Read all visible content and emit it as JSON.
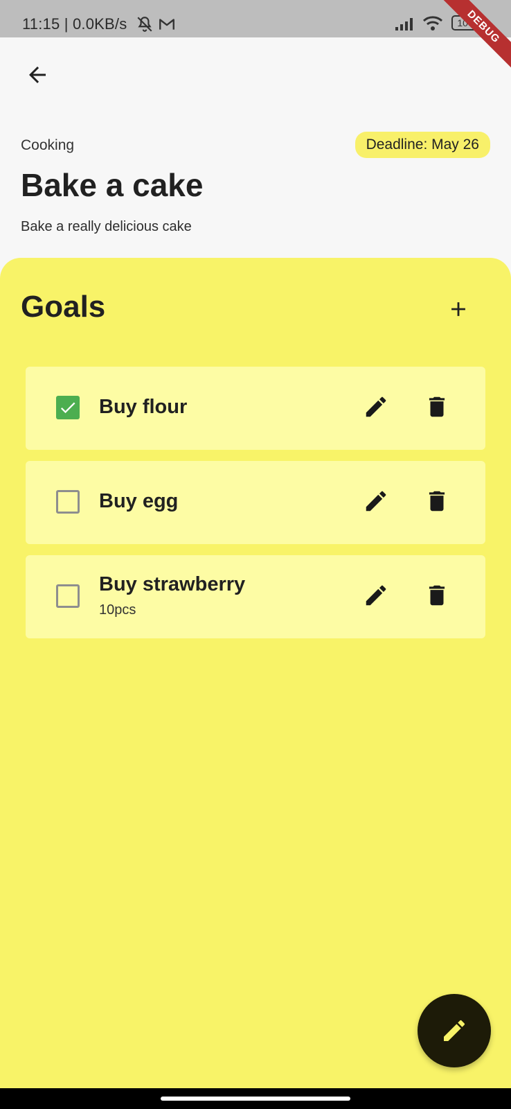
{
  "status_bar": {
    "time": "11:15",
    "network_speed": "0.0KB/s",
    "battery": "100",
    "debug_label": "DEBUG"
  },
  "header": {
    "category": "Cooking",
    "deadline": "Deadline: May 26",
    "title": "Bake a cake",
    "description": "Bake a really delicious cake"
  },
  "goals": {
    "title": "Goals",
    "items": [
      {
        "name": "Buy flour",
        "checked": true,
        "detail": ""
      },
      {
        "name": "Buy egg",
        "checked": false,
        "detail": ""
      },
      {
        "name": "Buy strawberry",
        "checked": false,
        "detail": "10pcs"
      }
    ]
  },
  "colors": {
    "panel": "#f8f368",
    "card": "#fdfca4",
    "check_accent": "#4cae50",
    "fab": "#1d1b08",
    "fab_icon": "#f8f368"
  }
}
